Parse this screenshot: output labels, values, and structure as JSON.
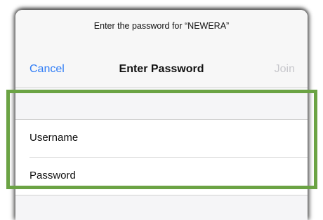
{
  "dialog": {
    "prompt": "Enter the password for “NEWERA”",
    "title": "Enter Password",
    "cancel_label": "Cancel",
    "join_label": "Join"
  },
  "fields": {
    "username_label": "Username",
    "password_label": "Password"
  },
  "colors": {
    "accent": "#2f7cf6",
    "disabled": "#c7c7cc",
    "highlight": "#6ba344"
  }
}
